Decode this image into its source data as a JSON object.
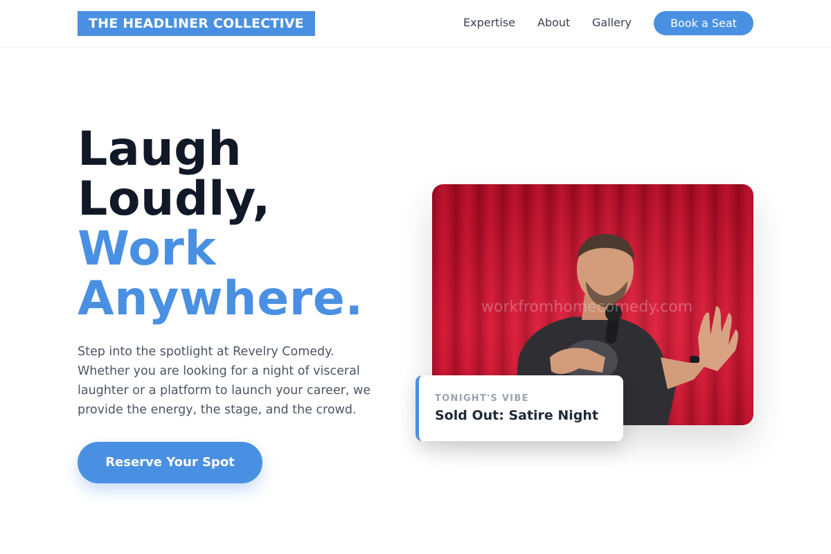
{
  "brand": {
    "logo_text": "THE HEADLINER COLLECTIVE"
  },
  "nav": {
    "links": [
      "Expertise",
      "About",
      "Gallery"
    ],
    "cta_label": "Book a Seat"
  },
  "hero": {
    "title_line1": "Laugh",
    "title_line2": "Loudly,",
    "title_line3": "Work",
    "title_line4": "Anywhere.",
    "description": "Step into the spotlight at Revelry Comedy. Whether you are looking for a night of visceral laughter or a platform to launch your career, we provide the energy, the stage, and the crowd.",
    "cta_label": "Reserve Your Spot"
  },
  "photo": {
    "watermark": "workfromhomecomedy.com",
    "subject": "comedian-on-stage-photo"
  },
  "vibe_card": {
    "label": "TONIGHT'S VIBE",
    "title": "Sold Out: Satire Night"
  },
  "colors": {
    "accent": "#4a90e2",
    "heading": "#111827",
    "body_text": "#4b5563",
    "curtain": "#c8102e"
  }
}
